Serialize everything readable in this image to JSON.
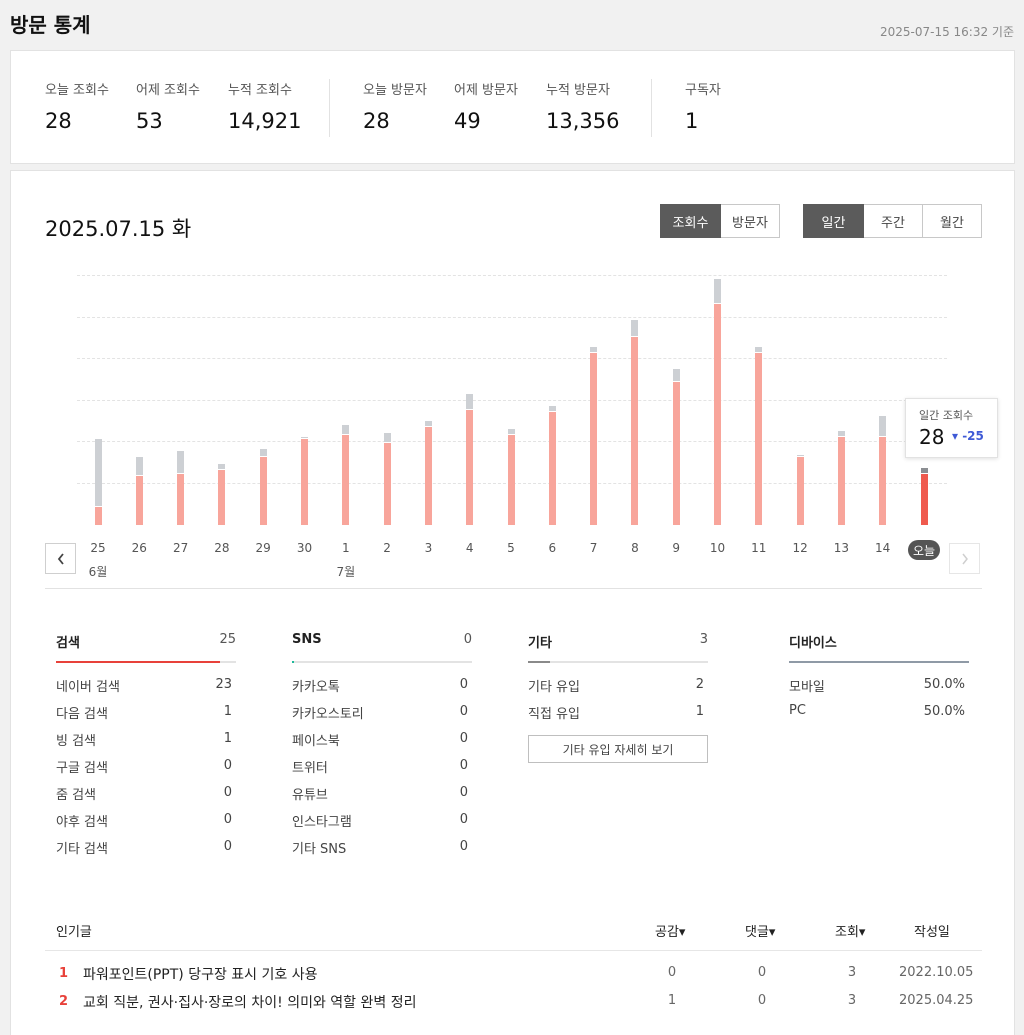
{
  "header": {
    "title": "방문 통계",
    "timestamp": "2025-07-15 16:32 기준"
  },
  "summary": {
    "stats": [
      {
        "label": "오늘 조회수",
        "value": "28"
      },
      {
        "label": "어제 조회수",
        "value": "53"
      },
      {
        "label": "누적 조회수",
        "value": "14,921"
      },
      {
        "label": "오늘 방문자",
        "value": "28"
      },
      {
        "label": "어제 방문자",
        "value": "49"
      },
      {
        "label": "누적 방문자",
        "value": "13,356"
      },
      {
        "label": "구독자",
        "value": "1"
      }
    ]
  },
  "chart_header": {
    "date": "2025.07.15 화",
    "metric_tabs": [
      {
        "label": "조회수",
        "active": true
      },
      {
        "label": "방문자",
        "active": false
      }
    ],
    "period_tabs": [
      {
        "label": "일간",
        "active": true
      },
      {
        "label": "주간",
        "active": false
      },
      {
        "label": "월간",
        "active": false
      }
    ]
  },
  "tooltip": {
    "label": "일간 조회수",
    "value": "28",
    "delta": "▾ -25"
  },
  "colors": {
    "visits": "#f8a59b",
    "today": "#ef5a4e",
    "extra": "#cdd0d4",
    "search": "#e8413a",
    "sns": "#1fb99a",
    "other": "#8a8a8a",
    "device": "#8f9aa6"
  },
  "chart_data": {
    "type": "bar",
    "title": "",
    "categories": [
      "25",
      "26",
      "27",
      "28",
      "29",
      "30",
      "1",
      "2",
      "3",
      "4",
      "5",
      "6",
      "7",
      "8",
      "9",
      "10",
      "11",
      "12",
      "13",
      "14",
      "오늘"
    ],
    "month_labels": {
      "25": "6월",
      "1": "7월"
    },
    "series": [
      {
        "values": [
          9,
          24,
          25,
          27,
          33,
          42,
          44,
          40,
          48,
          56,
          44,
          55,
          84,
          92,
          70,
          108,
          84,
          33,
          43,
          43,
          25
        ]
      },
      {
        "values": [
          33,
          9,
          11,
          3,
          4,
          1,
          5,
          5,
          3,
          8,
          3,
          3,
          3,
          8,
          6,
          12,
          3,
          1,
          3,
          10,
          3
        ]
      }
    ],
    "ylim": [
      0,
      124
    ],
    "grid": true,
    "highlight_index": 20
  },
  "chart_nav": {
    "prev": "‹",
    "next": "›"
  },
  "sources": {
    "search": {
      "title": "검색",
      "count": "25",
      "fill": 0.91,
      "rows": [
        {
          "label": "네이버 검색",
          "value": "23"
        },
        {
          "label": "다음 검색",
          "value": "1"
        },
        {
          "label": "빙 검색",
          "value": "1"
        },
        {
          "label": "구글 검색",
          "value": "0"
        },
        {
          "label": "줌 검색",
          "value": "0"
        },
        {
          "label": "야후 검색",
          "value": "0"
        },
        {
          "label": "기타 검색",
          "value": "0"
        }
      ]
    },
    "sns": {
      "title": "SNS",
      "count": "0",
      "fill": 0.01,
      "rows": [
        {
          "label": "카카오톡",
          "value": "0"
        },
        {
          "label": "카카오스토리",
          "value": "0"
        },
        {
          "label": "페이스북",
          "value": "0"
        },
        {
          "label": "트위터",
          "value": "0"
        },
        {
          "label": "유튜브",
          "value": "0"
        },
        {
          "label": "인스타그램",
          "value": "0"
        },
        {
          "label": "기타 SNS",
          "value": "0"
        }
      ]
    },
    "other": {
      "title": "기타",
      "count": "3",
      "fill": 0.12,
      "rows": [
        {
          "label": "기타 유입",
          "value": "2"
        },
        {
          "label": "직접 유입",
          "value": "1"
        }
      ],
      "detail_button": "기타 유입 자세히 보기"
    },
    "device": {
      "title": "디바이스",
      "count": "",
      "fill": 1.0,
      "rows": [
        {
          "label": "모바일",
          "value": "50.0%"
        },
        {
          "label": "PC",
          "value": "50.0%"
        }
      ]
    }
  },
  "popular": {
    "headers": {
      "title": "인기글",
      "likes": "공감▾",
      "comments": "댓글▾",
      "views": "조회▾",
      "date": "작성일"
    },
    "rows": [
      {
        "rank": "1",
        "title": "파워포인트(PPT) 당구장 표시 기호 사용",
        "likes": "0",
        "comments": "0",
        "views": "3",
        "date": "2022.10.05"
      },
      {
        "rank": "2",
        "title": "교회 직분, 권사·집사·장로의 차이! 의미와 역할 완벽 정리",
        "likes": "1",
        "comments": "0",
        "views": "3",
        "date": "2025.04.25"
      }
    ]
  }
}
